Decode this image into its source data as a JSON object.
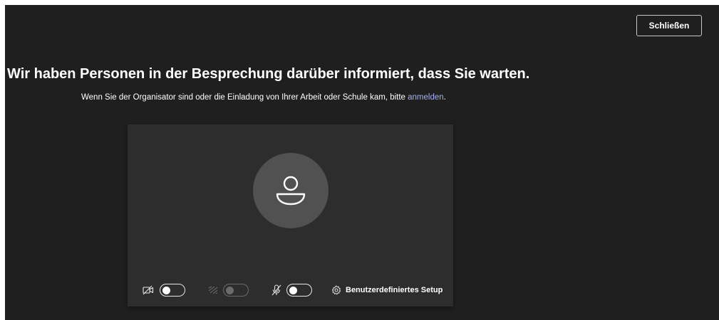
{
  "header": {
    "close_label": "Schließen"
  },
  "main": {
    "headline": "Wir haben Personen in der Besprechung darüber informiert, dass Sie warten.",
    "subline_text": "Wenn Sie der Organisator sind oder die Einladung von Ihrer Arbeit oder Schule kam, bitte ",
    "subline_link": "anmelden",
    "subline_end": "."
  },
  "preview": {
    "avatar_icon": "person-icon",
    "controls": {
      "camera": {
        "icon": "camera-off-icon",
        "enabled": false
      },
      "background": {
        "icon": "background-blur-icon",
        "enabled": false,
        "disabled": true
      },
      "microphone": {
        "icon": "mic-off-icon",
        "enabled": false
      },
      "setup_icon": "gear-icon",
      "setup_label": "Benutzerdefiniertes Setup"
    }
  },
  "colors": {
    "background": "#1f1f1f",
    "panel": "#2d2d2d",
    "avatar": "#515151",
    "link": "#a9adf0"
  }
}
